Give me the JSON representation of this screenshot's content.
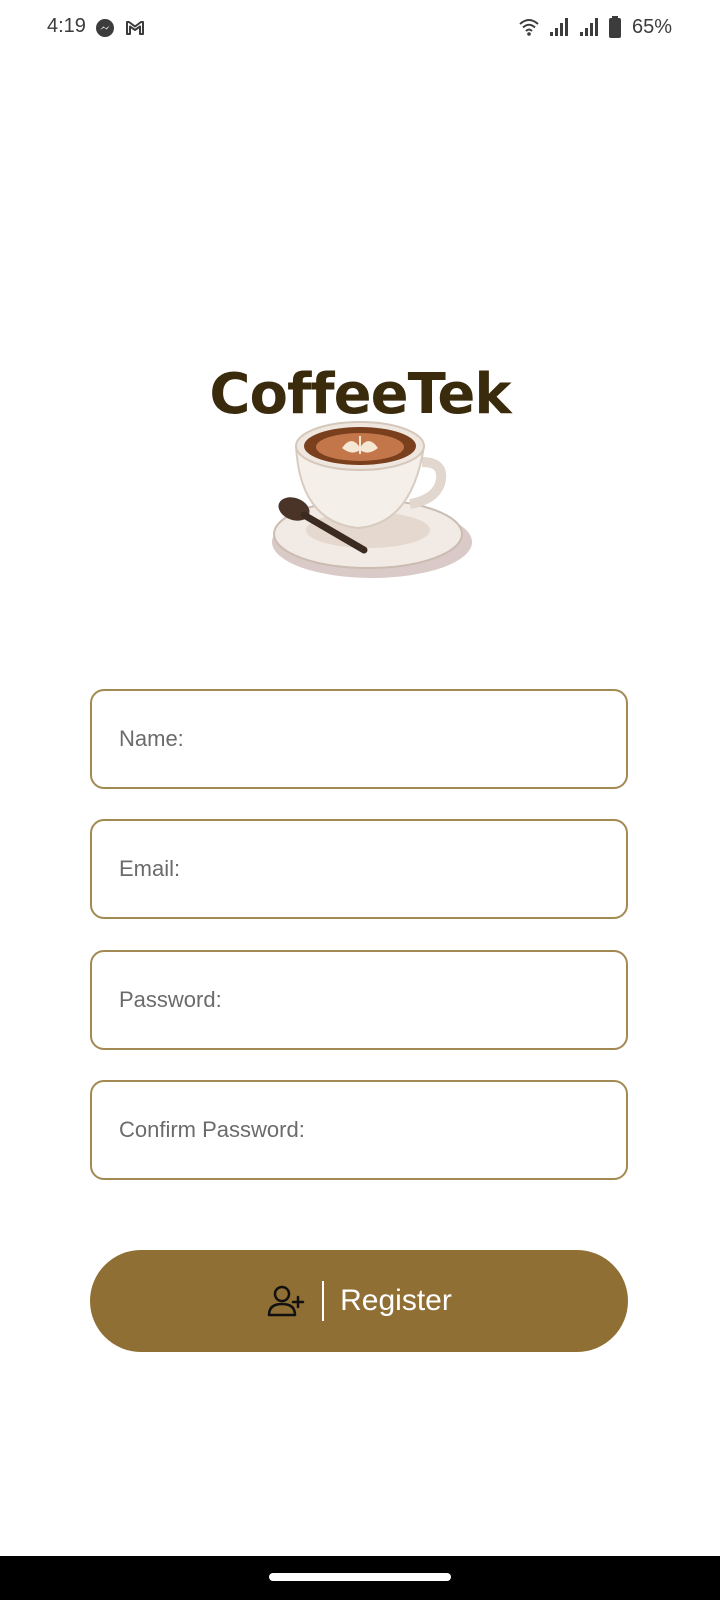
{
  "status_bar": {
    "time": "4:19",
    "left_icons": [
      "messenger-icon",
      "gmail-icon"
    ],
    "right_icons": [
      "wifi-icon",
      "signal-icon",
      "signal-icon",
      "battery-icon"
    ],
    "battery_percent": "65%"
  },
  "logo": {
    "title": "CoffeeTek"
  },
  "form": {
    "name_placeholder": "Name:",
    "email_placeholder": "Email:",
    "password_placeholder": "Password:",
    "confirm_password_placeholder": "Confirm Password:"
  },
  "register_button": {
    "label": "Register",
    "icon": "add-user-icon"
  },
  "colors": {
    "accent": "#8f6f33",
    "field_border": "#a28a52",
    "logo_text": "#3a2b0c"
  }
}
